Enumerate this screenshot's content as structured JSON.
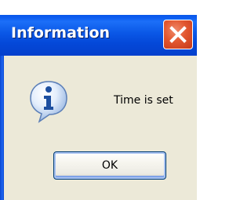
{
  "dialog": {
    "title": "Information",
    "message": "Time is set",
    "ok_label": "OK",
    "icon": "information-icon",
    "close_icon": "close-icon"
  },
  "colors": {
    "titlebar": "#0a57e6",
    "close_button": "#e2572f",
    "client_background": "#ece9d8",
    "button_border": "#003c74"
  }
}
